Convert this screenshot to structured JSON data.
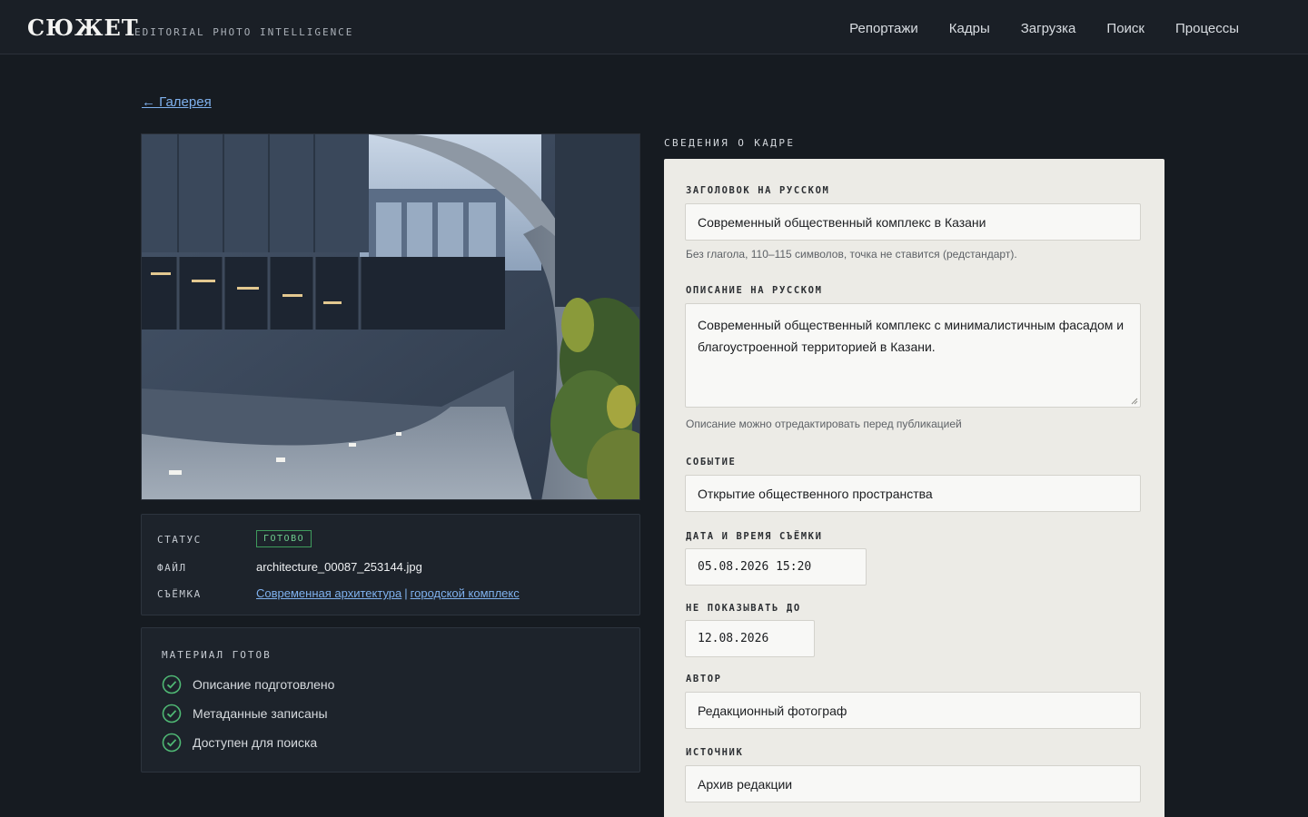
{
  "header": {
    "brand": "СЮЖЕТ",
    "tagline": "EDITORIAL PHOTO INTELLIGENCE",
    "nav": [
      "Репортажи",
      "Кадры",
      "Загрузка",
      "Поиск",
      "Процессы"
    ]
  },
  "back_link": "← Галерея",
  "meta": {
    "status_label": "СТАТУС",
    "status_value": "ГОТОВО",
    "file_label": "ФАЙЛ",
    "file_value": "architecture_00087_253144.jpg",
    "shoot_label": "СЪЁМКА",
    "shoot_tags": [
      "Современная архитектура",
      "городской комплекс"
    ],
    "shoot_separator": "|"
  },
  "ready": {
    "title": "МАТЕРИАЛ ГОТОВ",
    "items": [
      "Описание подготовлено",
      "Метаданные записаны",
      "Доступен для поиска"
    ]
  },
  "panel": {
    "heading": "СВЕДЕНИЯ О КАДРЕ",
    "title_label": "ЗАГОЛОВОК НА РУССКОМ",
    "title_value": "Современный общественный комплекс в Казани",
    "title_hint": "Без глагола, 110–115 символов, точка не ставится (редстандарт).",
    "desc_label": "ОПИСАНИЕ НА РУССКОМ",
    "desc_value": "Современный общественный комплекс с минималистичным фасадом и благоустроенной территорией в Казани.",
    "desc_hint": "Описание можно отредактировать перед публикацией",
    "event_label": "СОБЫТИЕ",
    "event_value": "Открытие общественного пространства",
    "datetime_label": "ДАТА И ВРЕМЯ СЪЁМКИ",
    "datetime_value": "05.08.2026 15:20",
    "embargo_label": "НЕ ПОКАЗЫВАТЬ ДО",
    "embargo_value": "12.08.2026",
    "author_label": "АВТОР",
    "author_value": "Редакционный фотограф",
    "source_label": "ИСТОЧНИК",
    "source_value": "Архив редакции"
  },
  "colors": {
    "background": "#161b21",
    "accent_link": "#7fb1ee",
    "status_green": "#6fcf8f",
    "form_bg": "#ecebe6"
  }
}
